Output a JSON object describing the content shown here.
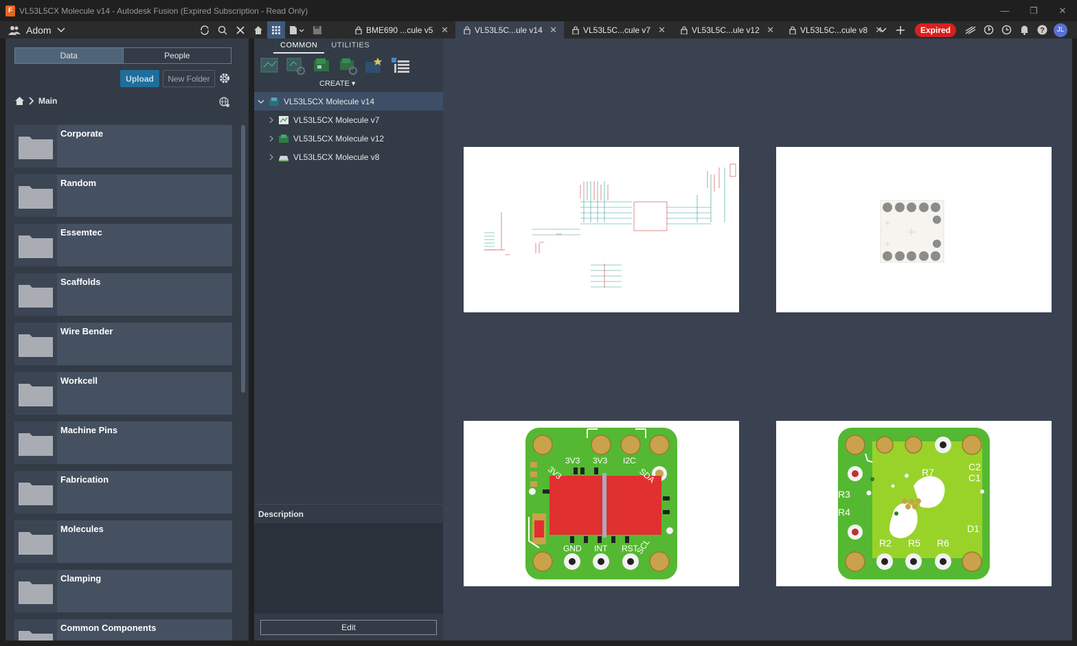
{
  "window": {
    "title": "VL53L5CX Molecule v14 - Autodesk Fusion (Expired Subscription - Read Only)"
  },
  "team": {
    "name": "Adom"
  },
  "tabs": [
    {
      "label": "BME690 ...cule v5",
      "locked": true,
      "active": false
    },
    {
      "label": "VL53L5C...ule v14",
      "locked": true,
      "active": true
    },
    {
      "label": "VL53L5C...cule v7",
      "locked": true,
      "active": false
    },
    {
      "label": "VL53L5C...ule v12",
      "locked": true,
      "active": false
    },
    {
      "label": "VL53L5C...cule v8",
      "locked": true,
      "active": false
    }
  ],
  "status": {
    "expired_label": "Expired",
    "user_initials": "JL"
  },
  "data_panel": {
    "segment_data": "Data",
    "segment_people": "People",
    "upload_label": "Upload",
    "new_folder_label": "New Folder",
    "breadcrumb": "Main",
    "folders": [
      "Corporate",
      "Random",
      "Essemtec",
      "Scaffolds",
      "Wire Bender",
      "Workcell",
      "Machine Pins",
      "Fabrication",
      "Molecules",
      "Clamping",
      "Common Components"
    ]
  },
  "browser": {
    "tab_common": "COMMON",
    "tab_utilities": "UTILITIES",
    "create_label": "CREATE",
    "tree_root": "VL53L5CX Molecule v14",
    "tree_children": [
      "VL53L5CX Molecule v7",
      "VL53L5CX Molecule v12",
      "VL53L5CX Molecule v8"
    ],
    "description_label": "Description",
    "edit_label": "Edit"
  },
  "pcb_top": {
    "labels": [
      "3V3",
      "3V3",
      "I2C",
      "GND",
      "INT",
      "RST",
      "SCL",
      "3V3",
      "SDA"
    ]
  },
  "pcb_bottom": {
    "labels": [
      "R7",
      "C2",
      "C1",
      "R3",
      "R4",
      "R2",
      "R5",
      "R6",
      "D1"
    ]
  },
  "colors": {
    "pcb_green": "#55b832",
    "pcb_lime": "#99d32a",
    "pad_gold": "#c9a24a",
    "component_red": "#e03030",
    "expired_red": "#d8201e",
    "accent_blue": "#1f6e9c"
  }
}
